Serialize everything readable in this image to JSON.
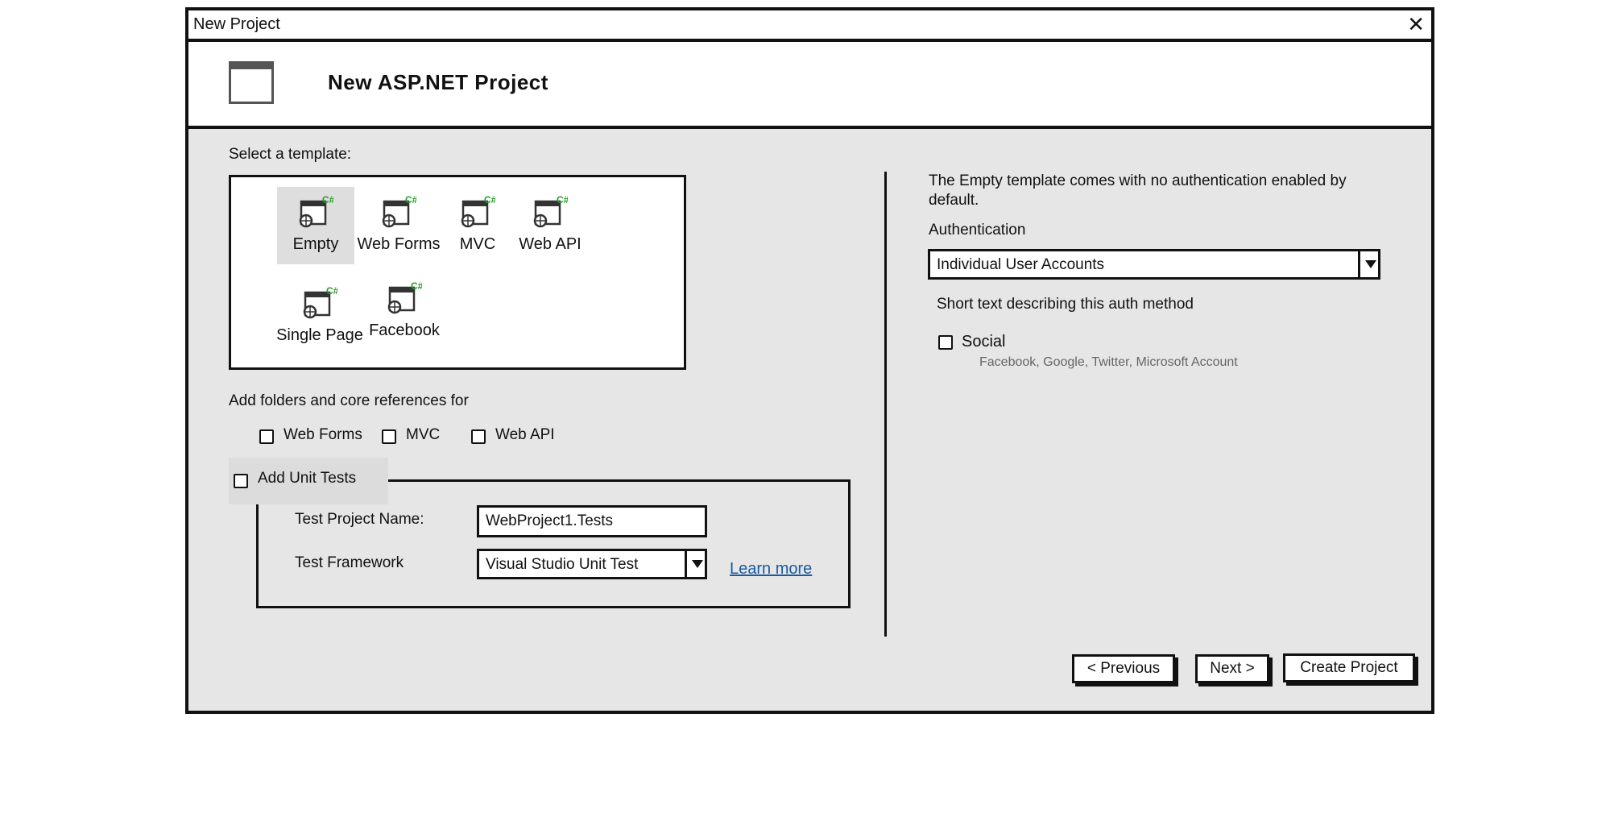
{
  "window": {
    "title": "New Project"
  },
  "header": {
    "title": "New ASP.NET Project"
  },
  "templates": {
    "label": "Select a template:",
    "items": [
      {
        "name": "Empty",
        "selected": true,
        "icon": "csharp-web-icon"
      },
      {
        "name": "Web Forms",
        "selected": false,
        "icon": "csharp-web-icon"
      },
      {
        "name": "MVC",
        "selected": false,
        "icon": "csharp-web-icon"
      },
      {
        "name": "Web API",
        "selected": false,
        "icon": "csharp-web-icon"
      },
      {
        "name": "Single Page",
        "selected": false,
        "icon": "csharp-web-icon"
      },
      {
        "name": "Facebook",
        "selected": false,
        "icon": "csharp-web-icon"
      }
    ]
  },
  "folders": {
    "label": "Add folders and core references for",
    "options": [
      {
        "label": "Web Forms",
        "checked": false
      },
      {
        "label": "MVC",
        "checked": false
      },
      {
        "label": "Web API",
        "checked": false
      }
    ]
  },
  "unit_tests": {
    "label": "Add Unit Tests",
    "checked": false,
    "project_name_label": "Test Project Name:",
    "project_name_value": "WebProject1.Tests",
    "framework_label": "Test Framework",
    "framework_value": "Visual Studio Unit Test",
    "learn_more": "Learn more"
  },
  "auth": {
    "description": "The Empty template comes with no authentication enabled by default.",
    "label": "Authentication",
    "selected": "Individual User Accounts",
    "method_text": "Short text describing this auth method",
    "social_label": "Social",
    "social_checked": false,
    "social_providers": "Facebook, Google, Twitter, Microsoft Account"
  },
  "buttons": {
    "previous": "< Previous",
    "next": "Next >",
    "create": "Create Project"
  },
  "colors": {
    "accent": "#2a9d2a",
    "link": "#1a5aa0",
    "panel": "#e6e6e6"
  }
}
